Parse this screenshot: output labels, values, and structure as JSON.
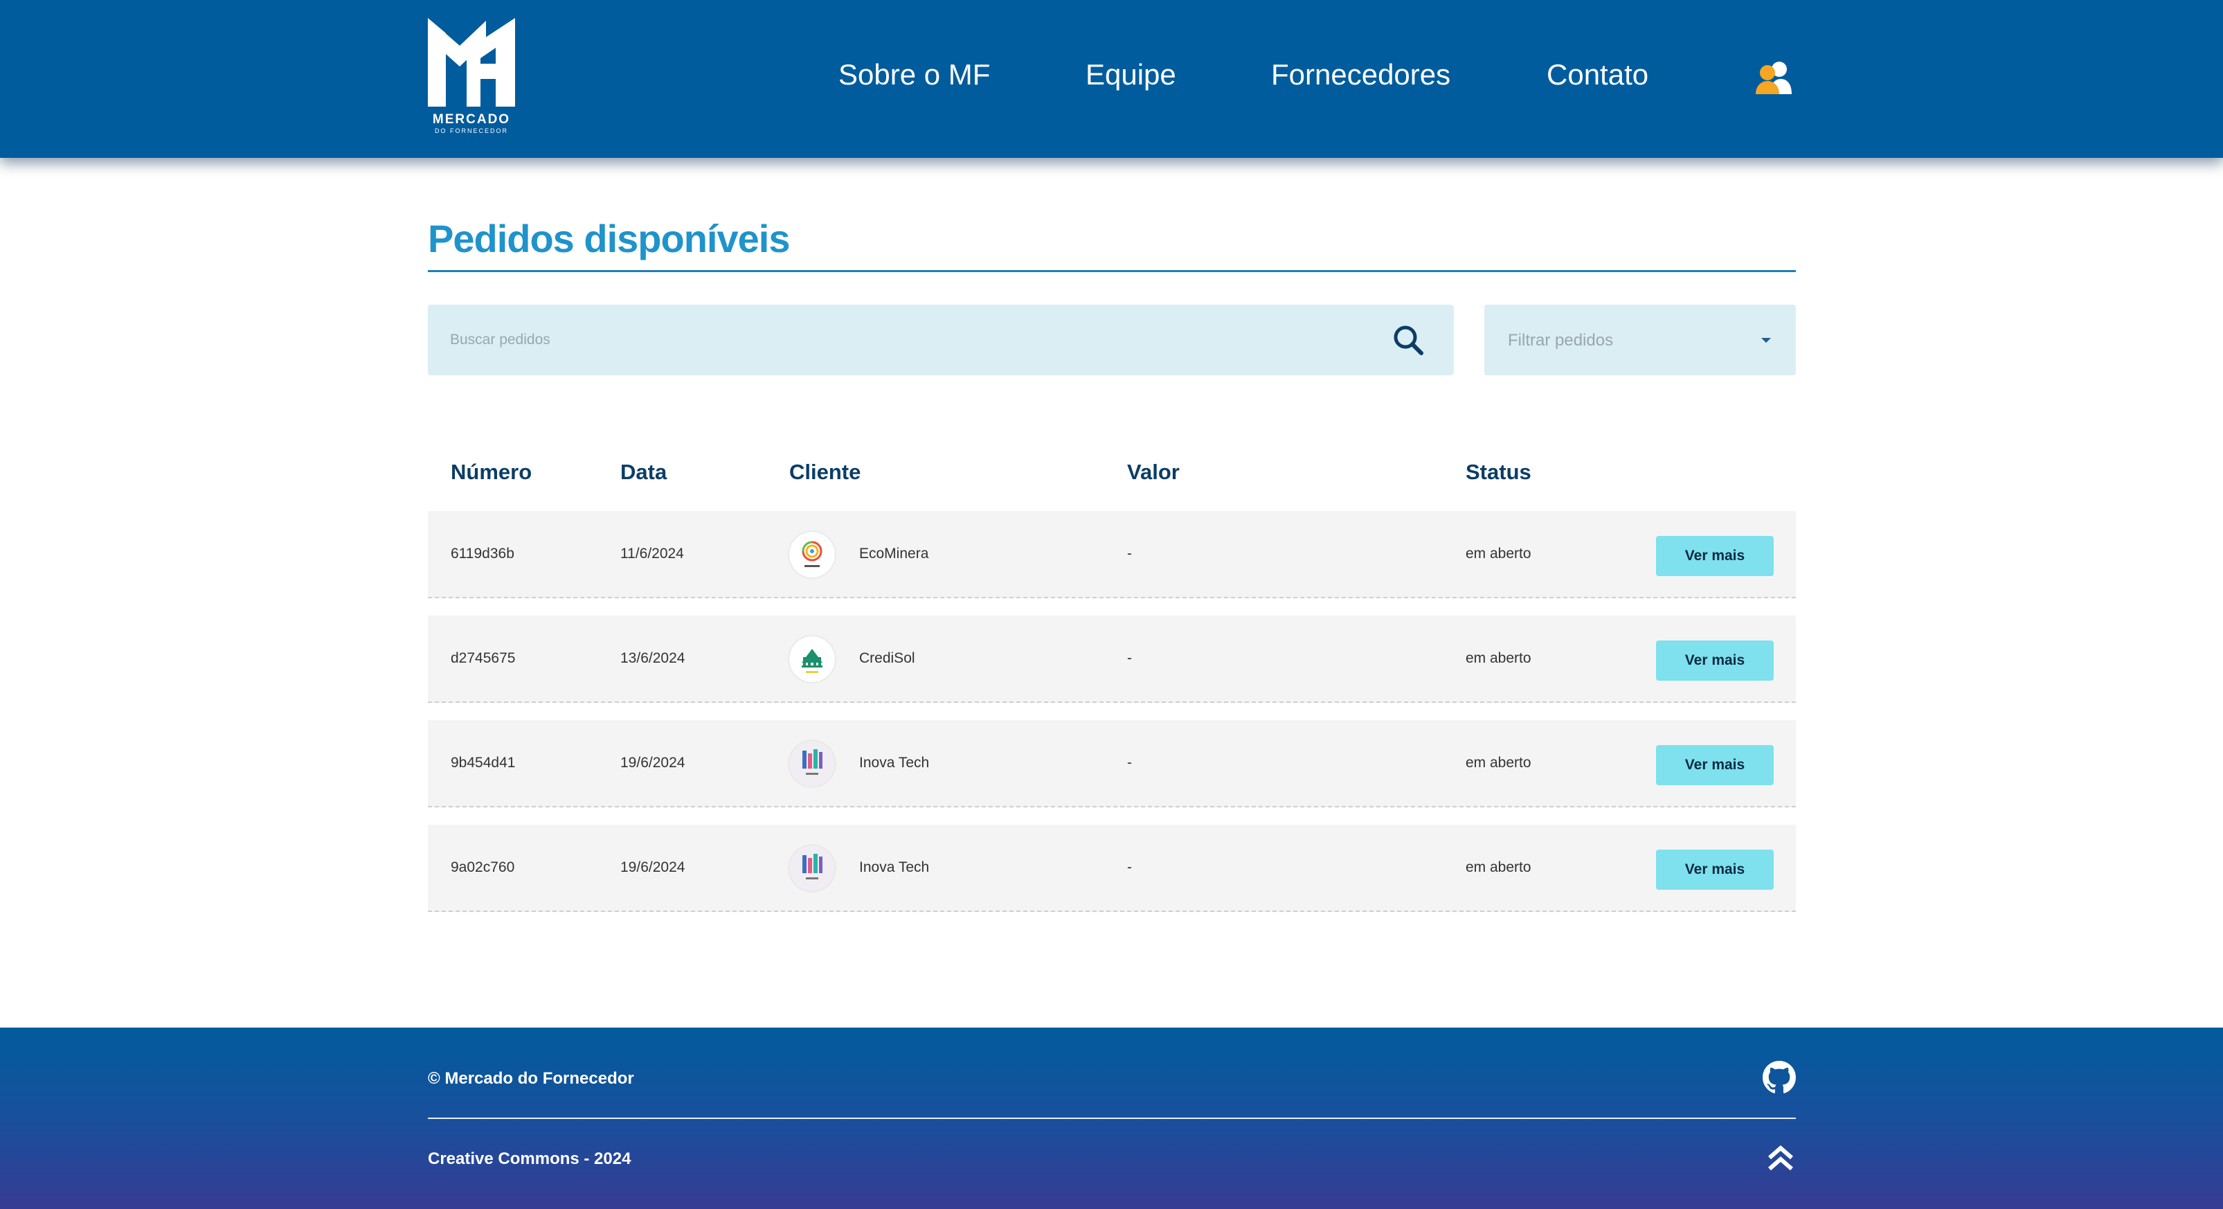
{
  "header": {
    "logo": {
      "word": "MERCADO",
      "sub": "DO FORNECEDOR"
    },
    "nav": [
      {
        "label": "Sobre o MF"
      },
      {
        "label": "Equipe"
      },
      {
        "label": "Fornecedores"
      },
      {
        "label": "Contato"
      }
    ],
    "user_icon": "users-icon"
  },
  "main": {
    "title": "Pedidos disponíveis",
    "search": {
      "placeholder": "Buscar pedidos",
      "icon": "search-icon"
    },
    "filter": {
      "label": "Filtrar pedidos"
    },
    "columns": [
      "Número",
      "Data",
      "Cliente",
      "Valor",
      "Status"
    ],
    "orders": [
      {
        "numero": "6119d36b",
        "data": "11/6/2024",
        "cliente": "EcoMinera",
        "valor": "-",
        "status": "em aberto",
        "action": "Ver mais"
      },
      {
        "numero": "d2745675",
        "data": "13/6/2024",
        "cliente": "CrediSol",
        "valor": "-",
        "status": "em aberto",
        "action": "Ver mais"
      },
      {
        "numero": "9b454d41",
        "data": "19/6/2024",
        "cliente": "Inova Tech",
        "valor": "-",
        "status": "em aberto",
        "action": "Ver mais"
      },
      {
        "numero": "9a02c760",
        "data": "19/6/2024",
        "cliente": "Inova Tech",
        "valor": "-",
        "status": "em aberto",
        "action": "Ver mais"
      }
    ]
  },
  "footer": {
    "copyright": "© Mercado do Fornecedor",
    "license": "Creative Commons - 2024",
    "github_icon": "github-icon",
    "top_icon": "double-chevron-up-icon"
  },
  "colors": {
    "header_bg": "#005c9d",
    "title": "#1f93cb",
    "button_bg": "#7fe0ee",
    "search_bg": "#dbeef4",
    "user_icon_accent": "#f5a623"
  }
}
